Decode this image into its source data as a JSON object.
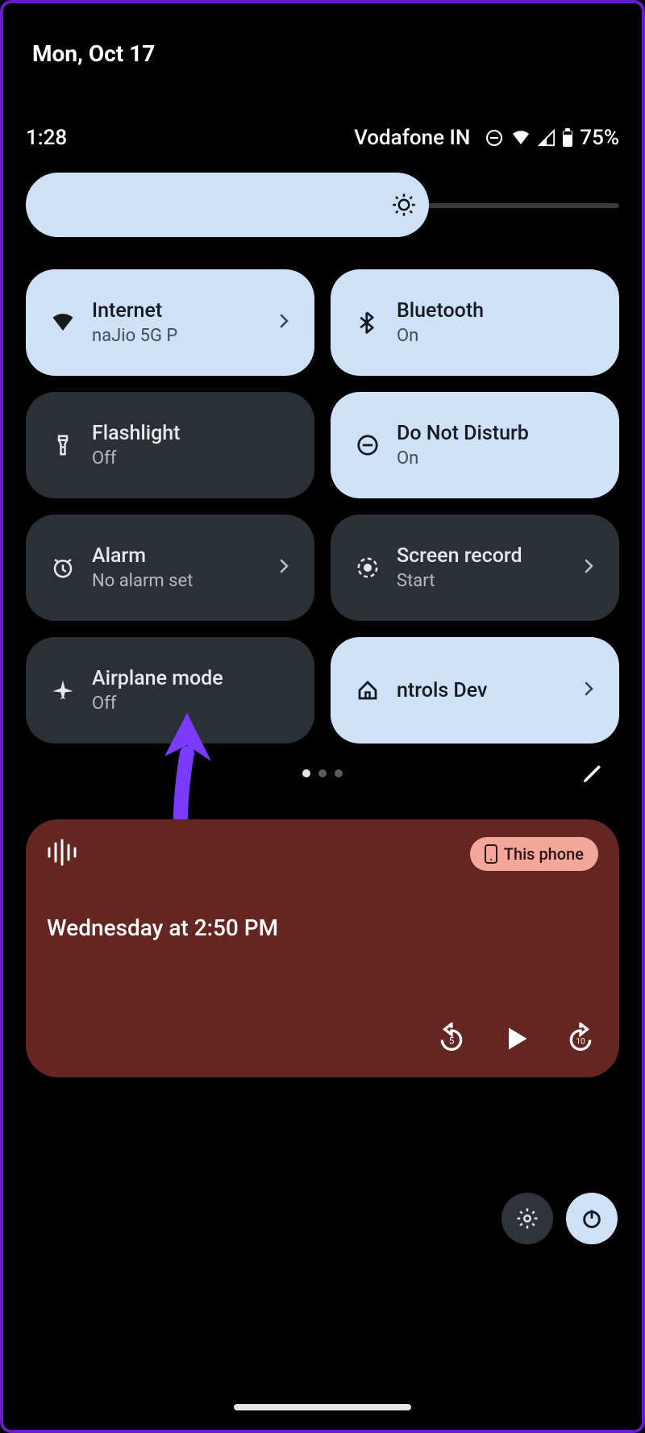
{
  "date": "Mon, Oct 17",
  "status": {
    "time": "1:28",
    "carrier": "Vodafone IN",
    "battery": "75%"
  },
  "brightness": {
    "percent": 68
  },
  "tiles": [
    {
      "id": "internet",
      "title": "Internet",
      "sub": "naJio 5G       P",
      "on": true,
      "chevron": true,
      "icon": "wifi"
    },
    {
      "id": "bluetooth",
      "title": "Bluetooth",
      "sub": "On",
      "on": true,
      "chevron": false,
      "icon": "bluetooth"
    },
    {
      "id": "flashlight",
      "title": "Flashlight",
      "sub": "Off",
      "on": false,
      "chevron": false,
      "icon": "flashlight"
    },
    {
      "id": "dnd",
      "title": "Do Not Disturb",
      "sub": "On",
      "on": true,
      "chevron": false,
      "icon": "dnd"
    },
    {
      "id": "alarm",
      "title": "Alarm",
      "sub": "No alarm set",
      "on": false,
      "chevron": true,
      "icon": "alarm"
    },
    {
      "id": "screenrec",
      "title": "Screen record",
      "sub": "Start",
      "on": false,
      "chevron": true,
      "icon": "record"
    },
    {
      "id": "airplane",
      "title": "Airplane mode",
      "sub": "Off",
      "on": false,
      "chevron": false,
      "icon": "airplane"
    },
    {
      "id": "devctrls",
      "title": "ntrols      Dev",
      "sub": "",
      "on": true,
      "chevron": true,
      "icon": "home"
    }
  ],
  "pager": {
    "pages": 3,
    "active": 0
  },
  "media": {
    "chip": "This phone",
    "title": "Wednesday at 2:50 PM"
  }
}
